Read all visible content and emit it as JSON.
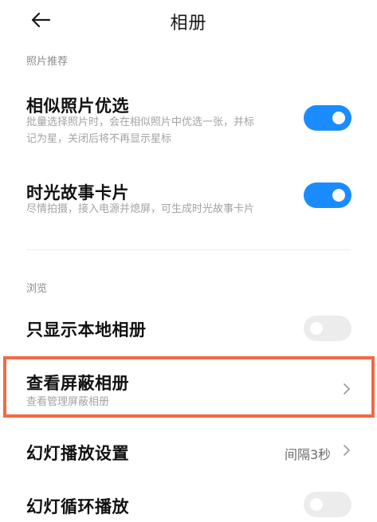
{
  "header": {
    "title": "相册"
  },
  "sections": {
    "photo_recommend": {
      "label": "照片推荐"
    },
    "browse": {
      "label": "浏览"
    }
  },
  "items": {
    "similar_photos": {
      "title": "相似照片优选",
      "desc_line1": "批量选择照片时，会在相似照片中优选一张，并标",
      "desc_line2": "记为星，关闭后将不再显示星标",
      "toggle": "on"
    },
    "story_cards": {
      "title": "时光故事卡片",
      "desc": "尽情拍摄，接入电源并熄屏，可生成时光故事卡片",
      "toggle": "on"
    },
    "local_albums_only": {
      "title": "只显示本地相册",
      "toggle": "off"
    },
    "hidden_albums": {
      "title": "查看屏蔽相册",
      "desc": "查看管理屏蔽相册"
    },
    "slideshow_settings": {
      "title": "幻灯播放设置",
      "value": "间隔3秒"
    },
    "slideshow_loop": {
      "title": "幻灯循环播放",
      "toggle": "off"
    }
  },
  "colors": {
    "accent": "#1a8cff",
    "toggle_off": "#ececec",
    "highlight": "#f26a45"
  }
}
